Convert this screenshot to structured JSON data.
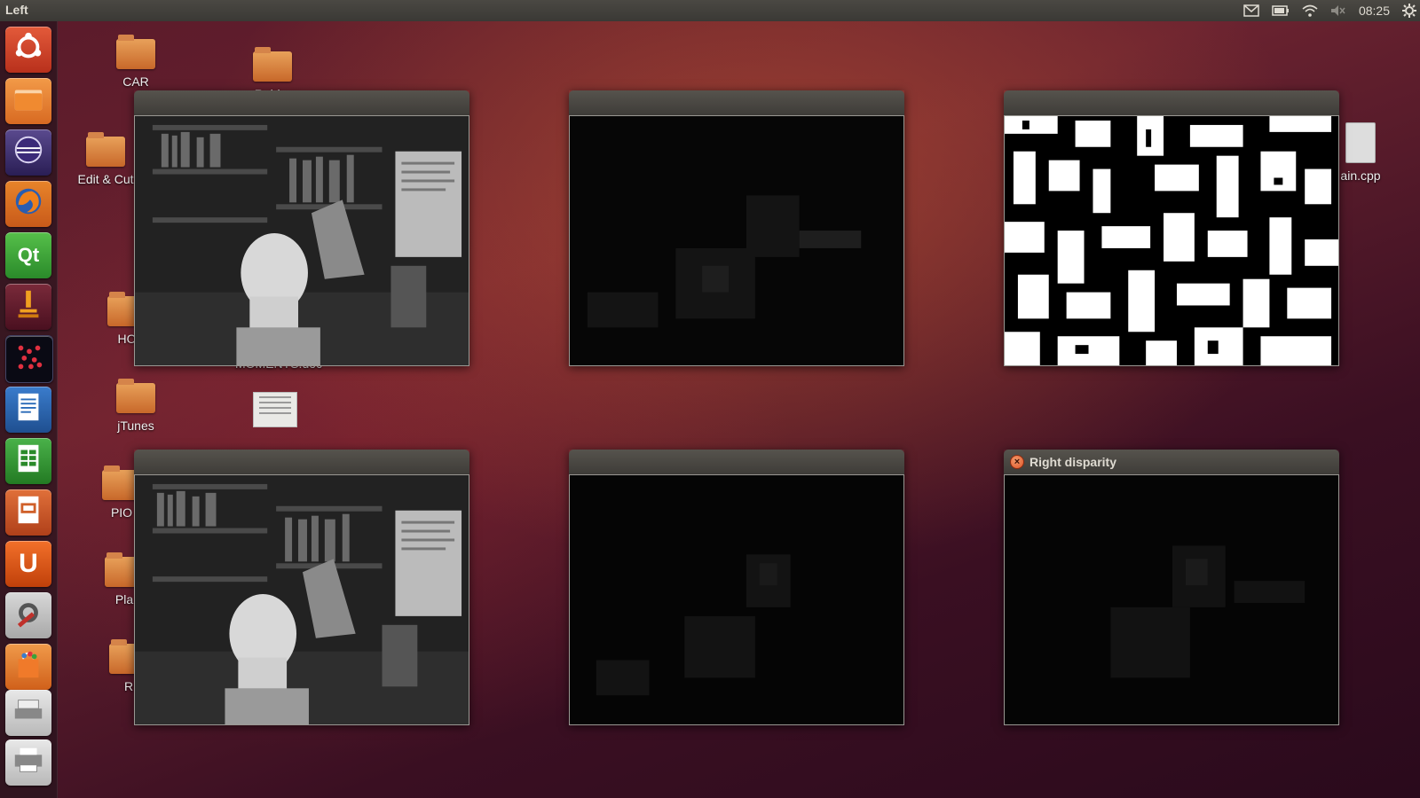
{
  "topbar": {
    "active_window": "Left",
    "clock": "08:25",
    "tray_icons": [
      "mail-icon",
      "battery-icon",
      "wifi-icon",
      "volume-muted-icon",
      "settings-gear-icon"
    ]
  },
  "launcher": {
    "items": [
      {
        "name": "dash-home",
        "icon": "ubuntu-logo-icon",
        "color": "#d9472b"
      },
      {
        "name": "files",
        "icon": "folder-icon",
        "color": "#e8852e"
      },
      {
        "name": "eclipse",
        "icon": "eclipse-icon",
        "color": "#3b2a6b"
      },
      {
        "name": "firefox",
        "icon": "firefox-icon",
        "color": "#2a5db0"
      },
      {
        "name": "qt-creator",
        "icon": "qt-icon",
        "label": "Qt",
        "color": "#3aa23a"
      },
      {
        "name": "microscope-app",
        "icon": "microscope-icon",
        "color": "#e07a1a"
      },
      {
        "name": "dots-app",
        "icon": "dots-icon",
        "color": "#111111"
      },
      {
        "name": "libreoffice-writer",
        "icon": "writer-icon",
        "color": "#2a6bb8"
      },
      {
        "name": "libreoffice-calc",
        "icon": "calc-icon",
        "color": "#3a9a3a"
      },
      {
        "name": "libreoffice-impress",
        "icon": "impress-icon",
        "color": "#d0602a"
      },
      {
        "name": "ubuntu-one",
        "icon": "ubuntu-one-icon",
        "label": "U",
        "color": "#e0551a"
      },
      {
        "name": "system-settings",
        "icon": "settings-icon",
        "color": "#c0302a"
      },
      {
        "name": "software-center",
        "icon": "shopping-bag-icon",
        "color": "#e0782a"
      },
      {
        "name": "scanner",
        "icon": "scanner-icon",
        "color": "#cfcfcf"
      },
      {
        "name": "printer",
        "icon": "printer-icon",
        "color": "#cfcfcf"
      }
    ]
  },
  "desktop": {
    "icons": [
      {
        "label": "CAR",
        "type": "folder"
      },
      {
        "label": "Rebi...",
        "type": "folder"
      },
      {
        "label": "Edit & Cut",
        "type": "folder"
      },
      {
        "label": "HO",
        "type": "folder"
      },
      {
        "label": "MOMENTS.doc",
        "type": "doc"
      },
      {
        "label": "jTunes",
        "type": "folder"
      },
      {
        "label": "PIO",
        "type": "folder"
      },
      {
        "label": "Pla",
        "type": "folder"
      },
      {
        "label": "R",
        "type": "folder"
      },
      {
        "label": "ain.cpp",
        "type": "cpp"
      }
    ]
  },
  "windows": [
    {
      "title": "",
      "content": "left-stereo-image",
      "focused": false
    },
    {
      "title": "",
      "content": "disparity-map",
      "focused": false
    },
    {
      "title": "",
      "content": "binary-map",
      "focused": false
    },
    {
      "title": "",
      "content": "right-stereo-image",
      "focused": false
    },
    {
      "title": "",
      "content": "disparity-map",
      "focused": false
    },
    {
      "title": "Right disparity",
      "content": "right-disparity-map",
      "focused": true,
      "close_symbol": "×"
    }
  ]
}
